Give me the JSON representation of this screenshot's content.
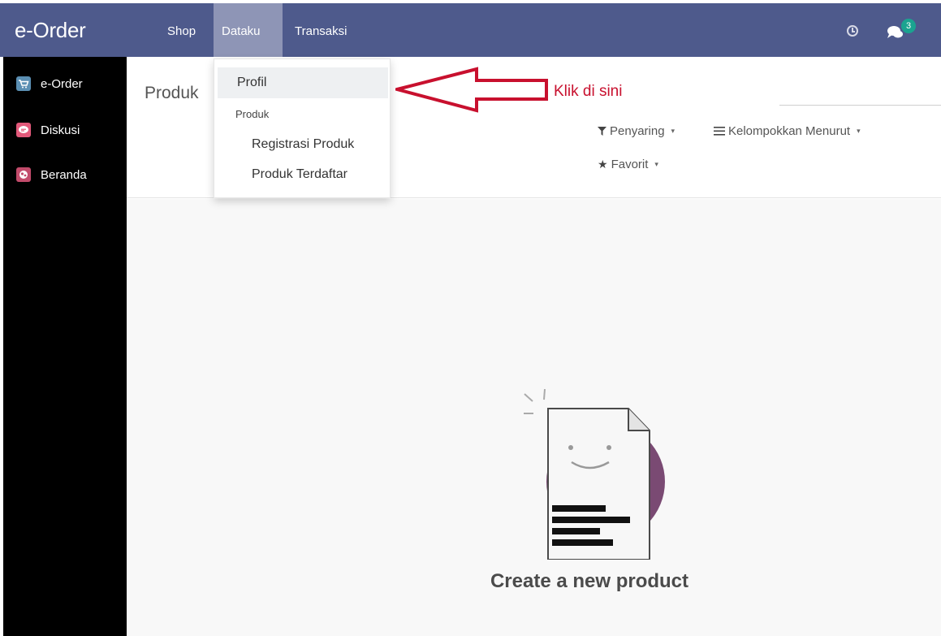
{
  "app": {
    "brand": "e-Order"
  },
  "topmenu": {
    "items": [
      {
        "label": "Shop"
      },
      {
        "label": "Dataku"
      },
      {
        "label": "Transaksi"
      }
    ],
    "active": "Dataku",
    "chat_badge": "3",
    "icons": [
      "clock-icon",
      "chat-icon"
    ]
  },
  "sidebar": {
    "items": [
      {
        "label": "e-Order",
        "icon": "cart-icon"
      },
      {
        "label": "Diskusi",
        "icon": "speech-bubble-icon"
      },
      {
        "label": "Beranda",
        "icon": "home-icon"
      }
    ]
  },
  "control": {
    "breadcrumb": "Produk",
    "filter_label": "Penyaring",
    "group_label": "Kelompokkan Menurut",
    "favorite_label": "Favorit"
  },
  "dropdown": {
    "profil": "Profil",
    "header": "Produk",
    "registrasi": "Registrasi Produk",
    "terdaftar": "Produk Terdaftar"
  },
  "annotation": {
    "text": "Klik di sini",
    "color": "#c8102e"
  },
  "empty_state": {
    "title": "Create a new product"
  },
  "colors": {
    "topbar": "#4e5a8c",
    "active_menu": "#8e95b6",
    "sidebar": "#000000",
    "badge": "#1ba390"
  }
}
